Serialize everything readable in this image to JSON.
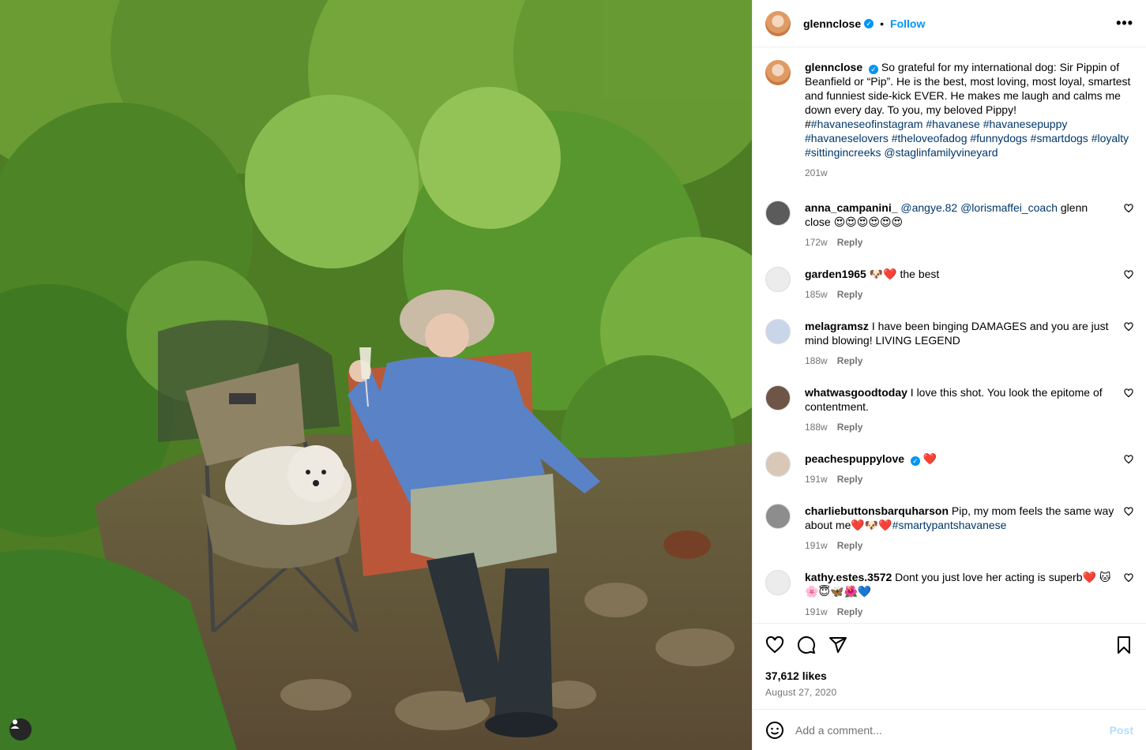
{
  "post": {
    "author": "glennclose",
    "follow_label": "Follow",
    "more_label": "•••"
  },
  "caption": {
    "author": "glennclose",
    "text": "So grateful for my international dog: Sir Pippin of Beanfield or “Pip”. He is the best, most loving, most loyal, smartest and funniest side-kick EVER. He makes me laugh and calms me down every day. To you, my beloved Pippy! #",
    "hashtags": "#havaneseofinstagram #havanese #havanesepuppy #havaneselovers #theloveofadog #funnydogs #smartdogs #loyalty #sittingincreeks @staglinfamilyvineyard",
    "time": "201w"
  },
  "comments": [
    {
      "user": "anna_campanini_",
      "mentions": "@angye.82 @lorismaffei_coach",
      "text": " glenn close 😍😍😍😍😍😍",
      "time": "172w",
      "reply": "Reply",
      "verified": false
    },
    {
      "user": "garden1965",
      "mentions": "",
      "text": "🐶❤️ the best",
      "time": "185w",
      "reply": "Reply",
      "verified": false
    },
    {
      "user": "melagramsz",
      "mentions": "",
      "text": "I have been binging DAMAGES and you are just mind blowing! LIVING LEGEND",
      "time": "188w",
      "reply": "Reply",
      "verified": false
    },
    {
      "user": "whatwasgoodtoday",
      "mentions": "",
      "text": "I love this shot. You look the epitome of contentment.",
      "time": "188w",
      "reply": "Reply",
      "verified": false
    },
    {
      "user": "peachespuppylove",
      "mentions": "",
      "text": "❤️",
      "time": "191w",
      "reply": "Reply",
      "verified": true
    },
    {
      "user": "charliebuttonsbarquharson",
      "mentions": "",
      "text": "Pip, my mom feels the same way about me❤️🐶❤️",
      "tail": "#smartypantshavanese",
      "time": "191w",
      "reply": "Reply",
      "verified": false
    },
    {
      "user": "kathy.estes.3572",
      "mentions": "",
      "text": "Dont you just love her acting is superb❤️ 🐱🌸😇🦋🌺💙",
      "time": "191w",
      "reply": "Reply",
      "verified": false
    }
  ],
  "likes": "37,612 likes",
  "date": "August 27, 2020",
  "add_comment": {
    "placeholder": "Add a comment...",
    "post_label": "Post"
  },
  "colors": {
    "accent": "#0095f6",
    "link": "#00376b",
    "muted": "#737373"
  },
  "icons": [
    "heart-icon",
    "comment-icon",
    "share-icon",
    "bookmark-icon",
    "emoji-icon",
    "user-tag-icon",
    "more-icon"
  ]
}
